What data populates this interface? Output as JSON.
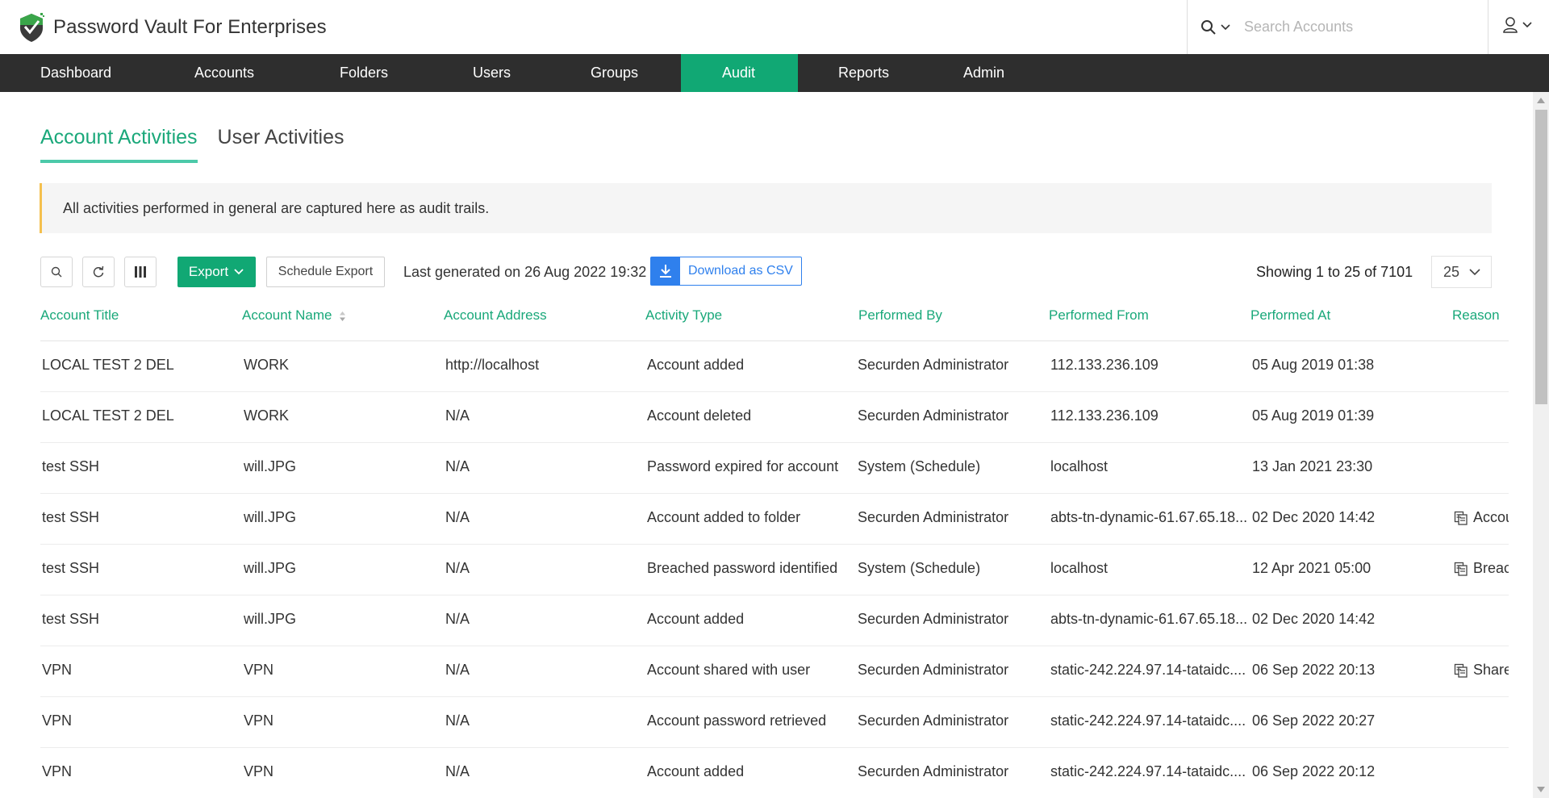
{
  "app": {
    "title": "Password Vault For Enterprises",
    "logo_icon": "shield-check-icon"
  },
  "header": {
    "search": {
      "icon": "search-icon",
      "placeholder": "Search Accounts",
      "value": ""
    },
    "user_menu_icon": "user-icon"
  },
  "nav": {
    "items": [
      {
        "label": "Dashboard",
        "active": false
      },
      {
        "label": "Accounts",
        "active": false
      },
      {
        "label": "Folders",
        "active": false
      },
      {
        "label": "Users",
        "active": false
      },
      {
        "label": "Groups",
        "active": false
      },
      {
        "label": "Audit",
        "active": true
      },
      {
        "label": "Reports",
        "active": false
      },
      {
        "label": "Admin",
        "active": false
      }
    ]
  },
  "tabs": [
    {
      "label": "Account Activities",
      "active": true
    },
    {
      "label": "User Activities",
      "active": false
    }
  ],
  "info_banner": "All activities performed in general are captured here as audit trails.",
  "toolbar": {
    "search_icon": "search-icon",
    "refresh_icon": "refresh-icon",
    "columns_icon": "columns-icon",
    "export_label": "Export",
    "schedule_export_label": "Schedule Export",
    "last_generated": "Last generated on 26 Aug 2022 19:32",
    "download_csv_label": "Download as CSV",
    "showing": "Showing 1 to 25 of 7101",
    "page_size": "25"
  },
  "table": {
    "columns": [
      {
        "label": "Account Title",
        "sortable": false
      },
      {
        "label": "Account Name",
        "sortable": true
      },
      {
        "label": "Account Address",
        "sortable": false
      },
      {
        "label": "Activity Type",
        "sortable": false
      },
      {
        "label": "Performed By",
        "sortable": false
      },
      {
        "label": "Performed From",
        "sortable": false
      },
      {
        "label": "Performed At",
        "sortable": false
      },
      {
        "label": "Reason",
        "sortable": false
      }
    ],
    "rows": [
      {
        "title": "LOCAL TEST 2 DEL",
        "name": "WORK",
        "address": "http://localhost",
        "activity": "Account added",
        "by": "Securden Administrator",
        "from": "112.133.236.109",
        "at": "05 Aug 2019 01:38",
        "reason": ""
      },
      {
        "title": "LOCAL TEST 2 DEL",
        "name": "WORK",
        "address": "N/A",
        "activity": "Account deleted",
        "by": "Securden Administrator",
        "from": "112.133.236.109",
        "at": "05 Aug 2019 01:39",
        "reason": ""
      },
      {
        "title": "test SSH",
        "name": "will.JPG",
        "address": "N/A",
        "activity": "Password expired for account",
        "by": "System (Schedule)",
        "from": "localhost",
        "at": "13 Jan 2021 23:30",
        "reason": ""
      },
      {
        "title": "test SSH",
        "name": "will.JPG",
        "address": "N/A",
        "activity": "Account added to folder",
        "by": "Securden Administrator",
        "from": "abts-tn-dynamic-61.67.65.18...",
        "at": "02 Dec 2020 14:42",
        "reason": "Accou"
      },
      {
        "title": "test SSH",
        "name": "will.JPG",
        "address": "N/A",
        "activity": "Breached password identified",
        "by": "System (Schedule)",
        "from": "localhost",
        "at": "12 Apr 2021 05:00",
        "reason": "Breac"
      },
      {
        "title": "test SSH",
        "name": "will.JPG",
        "address": "N/A",
        "activity": "Account added",
        "by": "Securden Administrator",
        "from": "abts-tn-dynamic-61.67.65.18...",
        "at": "02 Dec 2020 14:42",
        "reason": ""
      },
      {
        "title": "VPN",
        "name": "VPN",
        "address": "N/A",
        "activity": "Account shared with user",
        "by": "Securden Administrator",
        "from": "static-242.224.97.14-tataidc....",
        "at": "06 Sep 2022 20:13",
        "reason": "Share"
      },
      {
        "title": "VPN",
        "name": "VPN",
        "address": "N/A",
        "activity": "Account password retrieved",
        "by": "Securden Administrator",
        "from": "static-242.224.97.14-tataidc....",
        "at": "06 Sep 2022 20:27",
        "reason": ""
      },
      {
        "title": "VPN",
        "name": "VPN",
        "address": "N/A",
        "activity": "Account added",
        "by": "Securden Administrator",
        "from": "static-242.224.97.14-tataidc....",
        "at": "06 Sep 2022 20:12",
        "reason": ""
      }
    ]
  },
  "colors": {
    "brand_green": "#11a874",
    "header_text_green": "#1aa87a",
    "nav_bg": "#2e2e2e",
    "banner_accent": "#f5c04e",
    "csv_blue": "#2f80ed"
  }
}
